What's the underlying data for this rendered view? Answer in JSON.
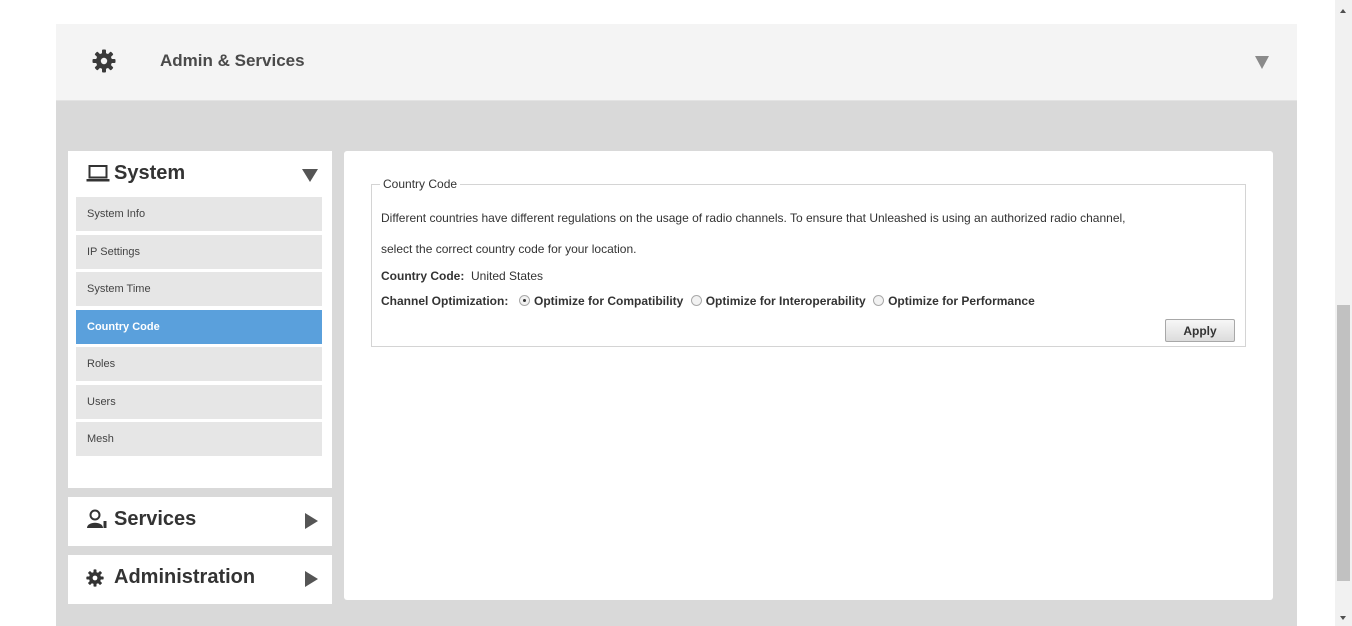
{
  "header": {
    "title": "Admin & Services"
  },
  "nav": {
    "system": {
      "label": "System",
      "items": [
        {
          "label": "System Info",
          "active": false
        },
        {
          "label": "IP Settings",
          "active": false
        },
        {
          "label": "System Time",
          "active": false
        },
        {
          "label": "Country Code",
          "active": true
        },
        {
          "label": "Roles",
          "active": false
        },
        {
          "label": "Users",
          "active": false
        },
        {
          "label": "Mesh",
          "active": false
        }
      ]
    },
    "services": {
      "label": "Services"
    },
    "administration": {
      "label": "Administration"
    }
  },
  "country_code": {
    "legend": "Country Code",
    "desc_line1": "Different countries have different regulations on the usage of radio channels. To ensure that Unleashed is using an authorized radio channel,",
    "desc_line2": "select the correct country code for your location.",
    "country_label": "Country Code:",
    "country_value": "United States",
    "optimization_label": "Channel Optimization:",
    "options": [
      {
        "label": "Optimize for Compatibility",
        "checked": true
      },
      {
        "label": "Optimize for Interoperability",
        "checked": false
      },
      {
        "label": "Optimize for Performance",
        "checked": false
      }
    ],
    "apply_label": "Apply"
  },
  "colors": {
    "accent": "#5aa0dc",
    "panel_bg": "#d9d9d9",
    "header_bg": "#f4f4f4"
  },
  "icons": {
    "header": "gear-icon",
    "system": "laptop-icon",
    "services": "services-user-icon",
    "administration": "gear-icon"
  }
}
